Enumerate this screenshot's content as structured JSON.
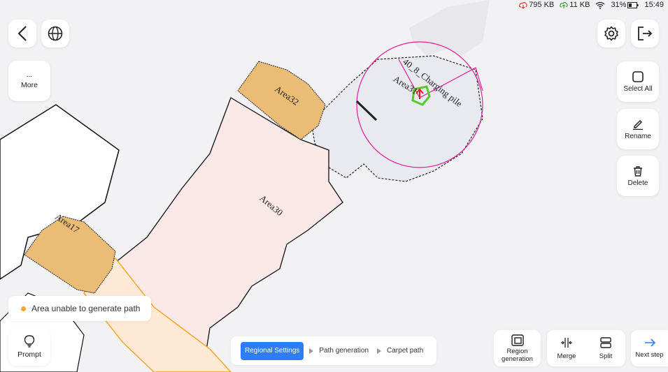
{
  "status": {
    "download": "795 KB",
    "upload": "11 KB",
    "battery": "31%",
    "time": "15:49"
  },
  "map": {
    "areas": [
      {
        "label": "Area32"
      },
      {
        "label": "Area30"
      },
      {
        "label": "Area17"
      },
      {
        "label": "Area31"
      }
    ],
    "station_label": "40_8_Charging pile",
    "colors": {
      "orange_area": "#ebbc75",
      "pink_area": "#fbe9e8",
      "peach_area": "#fde9d4",
      "gray_area": "#e9e9f0",
      "station": "#e0209a",
      "robot": "#5ac72e",
      "robot_arrow": "#e02020"
    }
  },
  "left_panel": {
    "more_dots": "...",
    "more_label": "More"
  },
  "right_panel": {
    "select_all": "Select All",
    "rename": "Rename",
    "delete": "Delete"
  },
  "toast": {
    "text": "Area unable to generate path"
  },
  "prompt": {
    "label": "Prompt"
  },
  "steps": {
    "active": "Regional Settings",
    "step2": "Path generation",
    "step3": "Carpet path"
  },
  "bottom_actions": {
    "region_generation": "Region generation",
    "merge": "Merge",
    "split": "Split",
    "next_step": "Next step"
  },
  "accent_color": "#2f7df6"
}
